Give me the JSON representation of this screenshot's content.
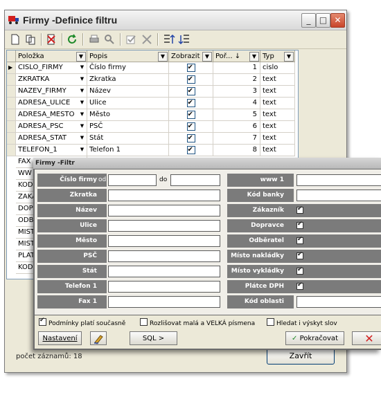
{
  "window": {
    "title": "Firmy -Definice filtru",
    "accent": "#c8442a"
  },
  "grid": {
    "columns": [
      "Položka",
      "Popis",
      "Zobrazit",
      "Poř... ↓",
      "Typ"
    ],
    "rows": [
      {
        "field": "CISLO_FIRMY",
        "label": "Číslo firmy",
        "show": true,
        "order": "1",
        "type": "cislo"
      },
      {
        "field": "ZKRATKA",
        "label": "Zkratka",
        "show": true,
        "order": "2",
        "type": "text"
      },
      {
        "field": "NAZEV_FIRMY",
        "label": "Název",
        "show": true,
        "order": "3",
        "type": "text"
      },
      {
        "field": "ADRESA_ULICE",
        "label": "Ulice",
        "show": true,
        "order": "4",
        "type": "text"
      },
      {
        "field": "ADRESA_MESTO",
        "label": "Město",
        "show": true,
        "order": "5",
        "type": "text"
      },
      {
        "field": "ADRESA_PSC",
        "label": "PSČ",
        "show": true,
        "order": "6",
        "type": "text"
      },
      {
        "field": "ADRESA_STAT",
        "label": "Stát",
        "show": true,
        "order": "7",
        "type": "text"
      },
      {
        "field": "TELEFON_1",
        "label": "Telefon 1",
        "show": true,
        "order": "8",
        "type": "text"
      }
    ],
    "partial_rows": [
      "FAX",
      "WW",
      "KOD",
      "ZAKA",
      "DOP",
      "ODB",
      "MIST",
      "MIST",
      "PLAT",
      "KOD"
    ]
  },
  "footer": {
    "count_text": "počet záznamů: 18",
    "close_label": "Zavřít"
  },
  "dialog": {
    "title": "Firmy -Filtr",
    "left_fields": [
      "Číslo firmy",
      "Zkratka",
      "Název",
      "Ulice",
      "Město",
      "PSČ",
      "Stát",
      "Telefon 1",
      "Fax 1"
    ],
    "range_from": "od",
    "range_to": "do",
    "right_fields": [
      {
        "label": "www 1",
        "kind": "input"
      },
      {
        "label": "Kód banky",
        "kind": "input"
      },
      {
        "label": "Zákazník",
        "kind": "check"
      },
      {
        "label": "Dopravce",
        "kind": "check"
      },
      {
        "label": "Odběratel",
        "kind": "check"
      },
      {
        "label": "Místo nakládky",
        "kind": "check"
      },
      {
        "label": "Místo vykládky",
        "kind": "check"
      },
      {
        "label": "Plátce DPH",
        "kind": "check"
      },
      {
        "label": "Kód oblasti",
        "kind": "input"
      }
    ],
    "options": {
      "all_conditions": "Podmínky platí současně",
      "case_sensitive": "Rozlišovat malá a VELKÁ písmena",
      "search_anywhere": "Hledat i výskyt slov"
    },
    "buttons": {
      "settings": "Nastavení",
      "sql": "SQL >",
      "continue": "Pokračovat"
    }
  }
}
